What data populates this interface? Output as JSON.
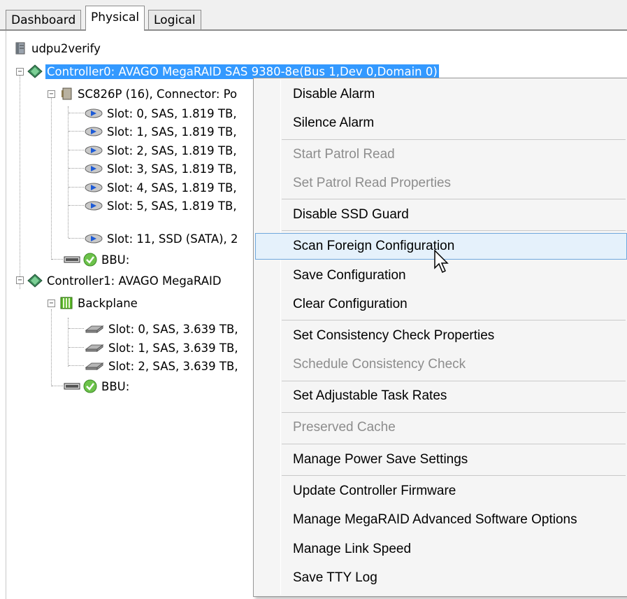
{
  "tabs": [
    "Dashboard",
    "Physical",
    "Logical"
  ],
  "active_tab": "Physical",
  "tree": {
    "root": "udpu2verify",
    "controller0": {
      "label": "Controller0: AVAGO MegaRAID SAS 9380-8e(Bus 1,Dev 0,Domain 0)",
      "enclosure": "SC826P (16), Connector: Po",
      "slots": [
        "Slot: 0, SAS, 1.819 TB,",
        "Slot: 1, SAS, 1.819 TB,",
        "Slot: 2, SAS, 1.819 TB,",
        "Slot: 3, SAS, 1.819 TB,",
        "Slot: 4, SAS, 1.819 TB,",
        "Slot: 5, SAS, 1.819 TB,",
        "Slot: 11, SSD  (SATA), 2"
      ],
      "bbu": "BBU:"
    },
    "controller1": {
      "label": "Controller1: AVAGO MegaRAID",
      "backplane": "Backplane",
      "slots": [
        "Slot: 0, SAS, 3.639 TB,",
        "Slot: 1, SAS, 3.639 TB,",
        "Slot: 2, SAS, 3.639 TB,"
      ],
      "bbu": "BBU:"
    }
  },
  "context_menu": {
    "items": [
      {
        "label": "Disable Alarm",
        "enabled": true
      },
      {
        "label": "Silence Alarm",
        "enabled": true
      },
      {
        "label": "Start Patrol Read",
        "enabled": false
      },
      {
        "label": "Set Patrol Read Properties",
        "enabled": false
      },
      {
        "label": "Disable SSD Guard",
        "enabled": true
      },
      {
        "label": "Scan Foreign Configuration",
        "enabled": true,
        "hovered": true
      },
      {
        "label": "Save Configuration",
        "enabled": true
      },
      {
        "label": "Clear Configuration",
        "enabled": true
      },
      {
        "label": "Set Consistency Check Properties",
        "enabled": true
      },
      {
        "label": "Schedule Consistency Check",
        "enabled": false
      },
      {
        "label": "Set Adjustable Task Rates",
        "enabled": true
      },
      {
        "label": "Preserved Cache",
        "enabled": false
      },
      {
        "label": "Manage Power Save Settings",
        "enabled": true
      },
      {
        "label": "Update Controller Firmware",
        "enabled": true
      },
      {
        "label": "Manage MegaRAID Advanced Software Options",
        "enabled": true
      },
      {
        "label": "Manage Link Speed",
        "enabled": true
      },
      {
        "label": "Save TTY Log",
        "enabled": true
      }
    ]
  },
  "colors": {
    "selection": "#3399ff",
    "menu_hover_bg": "#e5f1fb",
    "menu_hover_border": "#6fa8dc",
    "disabled_text": "#8d8d8d",
    "ok_badge": "#6cc24a"
  }
}
